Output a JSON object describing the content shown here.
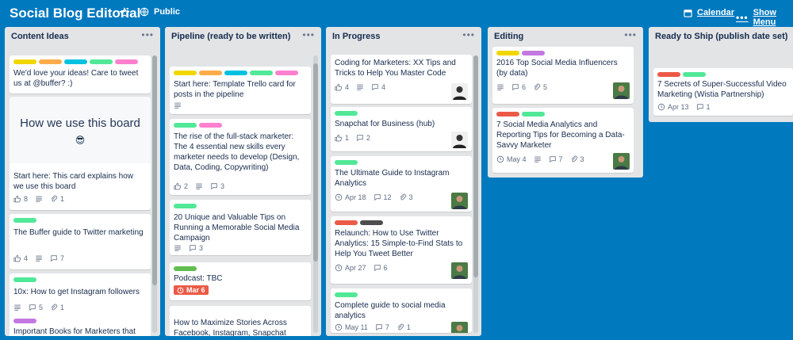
{
  "header": {
    "board_title": "Social Blog Editorial",
    "visibility": "Public",
    "calendar": "Calendar",
    "show_menu": "Show Menu"
  },
  "colors": {
    "board_bg": "#0079bf",
    "list_bg": "#e2e4e6",
    "yellow": "#f2d600",
    "orange": "#ffab4a",
    "sky": "#00c2e0",
    "green": "#51e898",
    "pink": "#ff80ce",
    "purple": "#c377e0",
    "red": "#eb5a46",
    "black": "#4d4d4d",
    "lime": "#61bd4f"
  },
  "lists": [
    {
      "title": "Content Ideas",
      "cards": [
        {
          "labels": [
            "yellow",
            "orange",
            "sky",
            "green",
            "pink"
          ],
          "title": "We'd love your ideas! Care to tweet us at @buffer? :)",
          "badges": []
        },
        {
          "cover_text": "How we use this board",
          "cover_emoji": "😎",
          "title": "Start here: This card explains how we use this board",
          "badges": [
            {
              "icon": "thumb-icon",
              "value": "8"
            },
            {
              "icon": "description-icon",
              "value": ""
            },
            {
              "icon": "attachment-icon",
              "value": "1"
            }
          ]
        },
        {
          "labels": [
            "green"
          ],
          "title": "The Buffer guide to Twitter marketing",
          "badges": [
            {
              "icon": "thumb-icon",
              "value": "4"
            },
            {
              "icon": "description-icon",
              "value": ""
            },
            {
              "icon": "comment-icon",
              "value": "7"
            }
          ]
        },
        {
          "labels": [
            "green"
          ],
          "title": "10x: How to get Instagram followers",
          "badges": [
            {
              "icon": "description-icon",
              "value": ""
            },
            {
              "icon": "comment-icon",
              "value": "5"
            },
            {
              "icon": "attachment-icon",
              "value": "1"
            }
          ]
        },
        {
          "labels": [
            "purple"
          ],
          "title": "Important Books for Marketers that",
          "badges": []
        }
      ]
    },
    {
      "title": "Pipeline (ready to be written)",
      "cards": [
        {
          "labels": [
            "yellow",
            "orange",
            "sky",
            "green",
            "pink"
          ],
          "title": "Start here: Template Trello card for posts in the pipeline",
          "badges": [
            {
              "icon": "description-icon",
              "value": ""
            }
          ]
        },
        {
          "labels": [
            "green",
            "pink"
          ],
          "title": "The rise of the full-stack marketer: The 4 essential new skills every marketer needs to develop (Design, Data, Coding, Copywriting)",
          "badges": [
            {
              "icon": "thumb-icon",
              "value": "2"
            },
            {
              "icon": "description-icon",
              "value": ""
            },
            {
              "icon": "comment-icon",
              "value": "3"
            }
          ]
        },
        {
          "labels": [
            "green"
          ],
          "title": "20 Unique and Valuable Tips on Running a Memorable Social Media Campaign",
          "badges": [
            {
              "icon": "description-icon",
              "value": ""
            },
            {
              "icon": "comment-icon",
              "value": "3"
            }
          ]
        },
        {
          "labels": [
            "lime"
          ],
          "title": "Podcast: TBC",
          "due_chip": "Mar 6",
          "badges": []
        },
        {
          "labels": [],
          "title": "How to Maximize Stories Across Facebook, Instagram, Snapchat",
          "badges": []
        }
      ]
    },
    {
      "title": "In Progress",
      "cards": [
        {
          "labels": [],
          "title": "Coding for Marketers: XX Tips and Tricks to Help You Master Code",
          "badges": [
            {
              "icon": "thumb-icon",
              "value": "4"
            },
            {
              "icon": "description-icon",
              "value": ""
            },
            {
              "icon": "comment-icon",
              "value": "4"
            }
          ],
          "avatar": "bw"
        },
        {
          "labels": [
            "green"
          ],
          "title": "Snapchat for Business (hub)",
          "badges": [
            {
              "icon": "thumb-icon",
              "value": "1"
            },
            {
              "icon": "comment-icon",
              "value": "2"
            }
          ],
          "avatar": "bw"
        },
        {
          "labels": [
            "green"
          ],
          "title": "The Ultimate Guide to Instagram Analytics",
          "badges": [
            {
              "icon": "clock-icon",
              "value": "Apr 18"
            },
            {
              "icon": "comment-icon",
              "value": "12"
            },
            {
              "icon": "attachment-icon",
              "value": "3"
            }
          ],
          "avatar": "green"
        },
        {
          "labels": [
            "red",
            "black"
          ],
          "title": "Relaunch: How to Use Twitter Analytics: 15 Simple-to-Find Stats to Help You Tweet Better",
          "badges": [
            {
              "icon": "clock-icon",
              "value": "Apr 27"
            },
            {
              "icon": "comment-icon",
              "value": "6"
            }
          ],
          "avatar": "green"
        },
        {
          "labels": [
            "green"
          ],
          "title": "Complete guide to social media analytics",
          "badges": [
            {
              "icon": "clock-icon",
              "value": "May 11"
            },
            {
              "icon": "comment-icon",
              "value": "7"
            },
            {
              "icon": "attachment-icon",
              "value": "1"
            }
          ],
          "avatar": "green"
        }
      ]
    },
    {
      "title": "Editing",
      "cards": [
        {
          "labels": [
            "yellow",
            "purple"
          ],
          "title": "2016 Top Social Media Influencers (by data)",
          "badges": [
            {
              "icon": "description-icon",
              "value": ""
            },
            {
              "icon": "comment-icon",
              "value": "6"
            },
            {
              "icon": "attachment-icon",
              "value": "5"
            }
          ],
          "avatar": "green"
        },
        {
          "labels": [
            "red",
            "green"
          ],
          "title": "7 Social Media Analytics and Reporting Tips for Becoming a Data-Savvy Marketer",
          "badges": [
            {
              "icon": "clock-icon",
              "value": "May 4"
            },
            {
              "icon": "description-icon",
              "value": ""
            },
            {
              "icon": "comment-icon",
              "value": "7"
            },
            {
              "icon": "attachment-icon",
              "value": "3"
            }
          ],
          "avatar": "green"
        }
      ]
    },
    {
      "title": "Ready to Ship (publish date set)",
      "cards": [
        {
          "labels": [
            "red",
            "green"
          ],
          "title": "7 Secrets of Super-Successful Video Marketing (Wistia Partnership)",
          "badges": [
            {
              "icon": "clock-icon",
              "value": "Apr 13"
            },
            {
              "icon": "comment-icon",
              "value": "1"
            }
          ]
        }
      ]
    }
  ]
}
